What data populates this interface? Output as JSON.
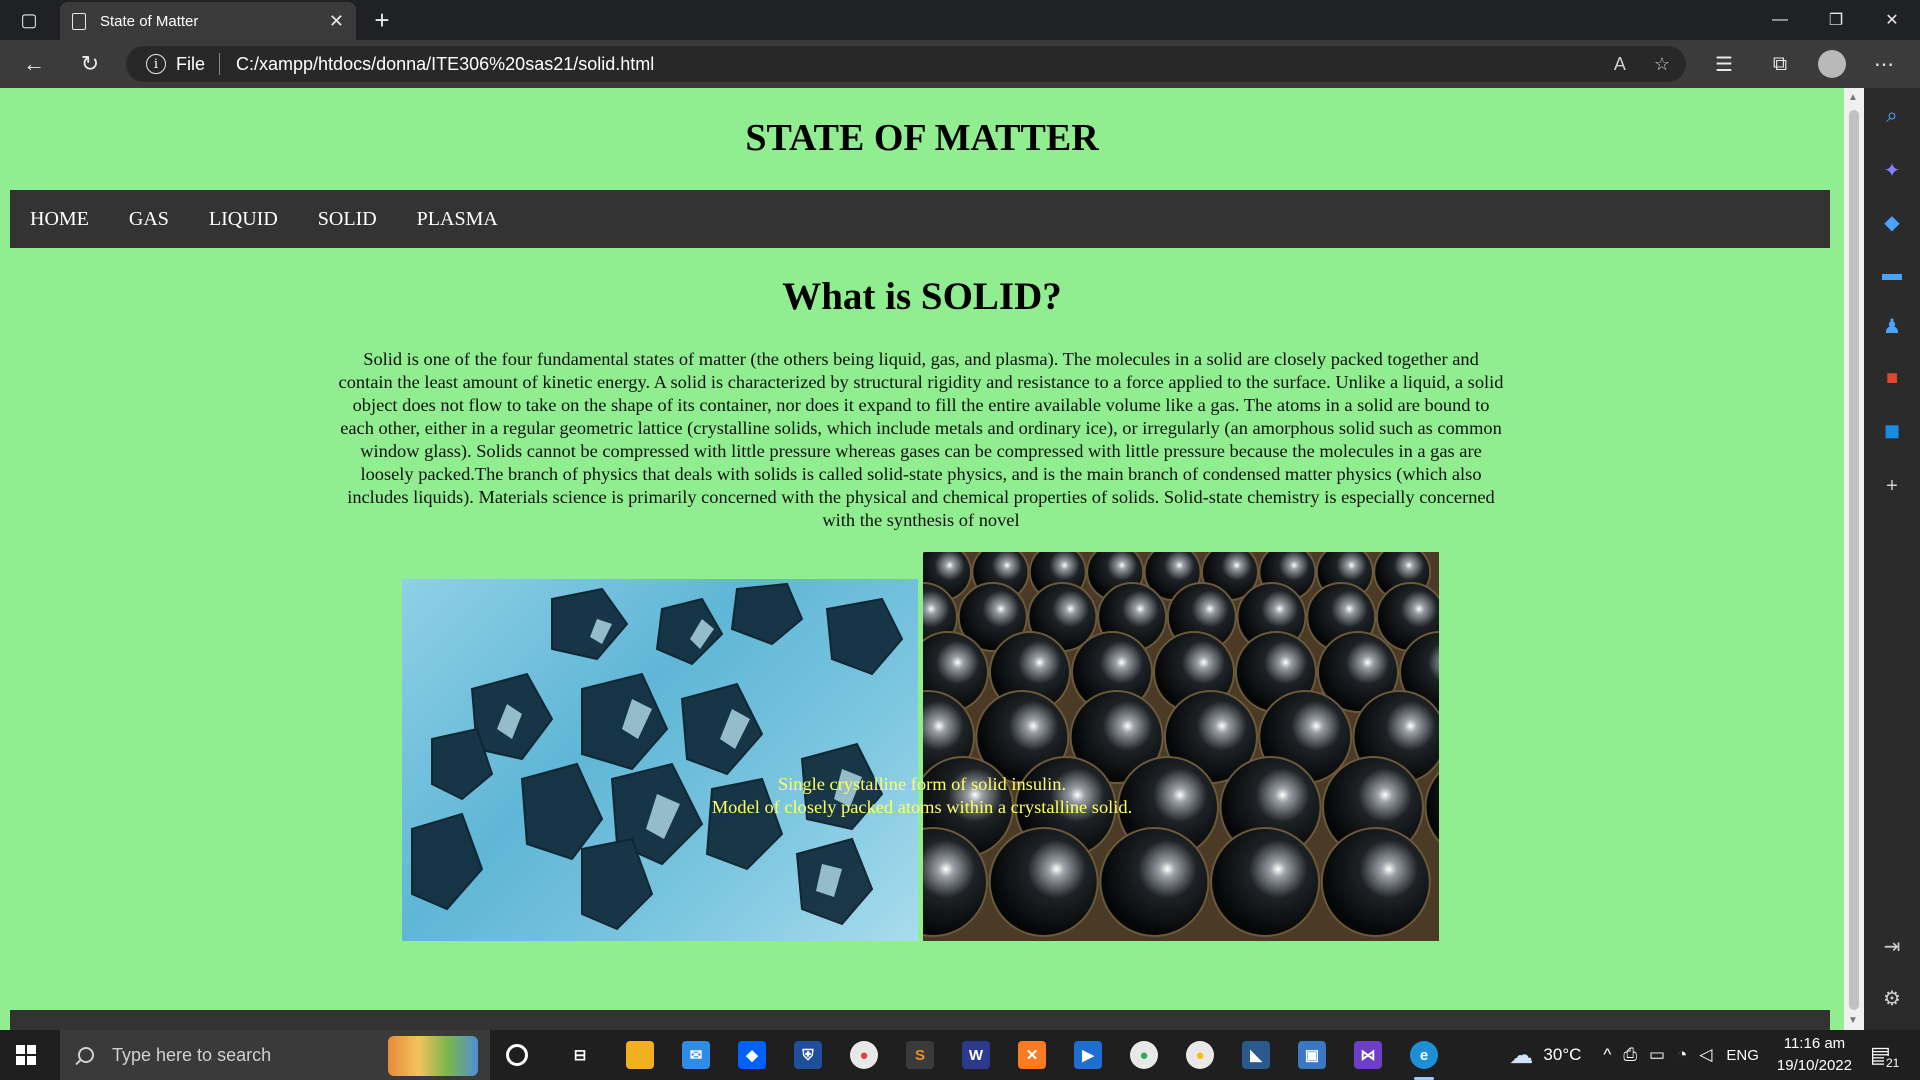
{
  "browser": {
    "tab_title": "State of Matter",
    "tab_close": "✕",
    "new_tab": "+",
    "address_label": "File",
    "url": "C:/xampp/htdocs/donna/ITE306%20sas21/solid.html",
    "caption_buttons": [
      "—",
      "❐",
      "✕"
    ]
  },
  "page": {
    "title": "STATE OF MATTER",
    "nav": [
      "HOME",
      "GAS",
      "LIQUID",
      "SOLID",
      "PLASMA"
    ],
    "section_title": "What is SOLID?",
    "paragraph": "Solid is one of the four fundamental states of matter (the others being liquid, gas, and plasma). The molecules in a solid are closely packed together and contain the least amount of kinetic energy. A solid is characterized by structural rigidity and resistance to a force applied to the surface. Unlike a liquid, a solid object does not flow to take on the shape of its container, nor does it expand to fill the entire available volume like a gas. The atoms in a solid are bound to each other, either in a regular geometric lattice (crystalline solids, which include metals and ordinary ice), or irregularly (an amorphous solid such as common window glass). Solids cannot be compressed with little pressure whereas gases can be compressed with little pressure because the molecules in a gas are loosely packed.The branch of physics that deals with solids is called solid-state physics, and is the main branch of condensed matter physics (which also includes liquids). Materials science is primarily concerned with the physical and chemical properties of solids. Solid-state chemistry is especially concerned with the synthesis of novel",
    "caption1": "Single crystalline form of solid insulin.",
    "caption2": "Model of closely packed atoms within a crystalline solid.",
    "colors": {
      "background": "#90ee90",
      "nav": "#333333",
      "caption": "#ffff66"
    }
  },
  "taskbar": {
    "search_placeholder": "Type here to search",
    "weather": "30°C",
    "language": "ENG",
    "time": "11:16 am",
    "date": "19/10/2022",
    "notifications": "21"
  }
}
